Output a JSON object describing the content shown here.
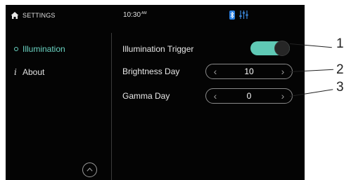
{
  "statusbar": {
    "title": "SETTINGS",
    "time": "10:30",
    "ampm": "AM"
  },
  "sidebar": {
    "items": [
      {
        "label": "Illumination",
        "icon": "dot-icon",
        "active": true
      },
      {
        "label": "About",
        "icon": "info-icon",
        "active": false
      }
    ],
    "info_glyph": "i"
  },
  "settings": {
    "illumination_trigger": {
      "label": "Illumination Trigger",
      "on": true
    },
    "brightness_day": {
      "label": "Brightness Day",
      "value": "10"
    },
    "gamma_day": {
      "label": "Gamma Day",
      "value": "0"
    }
  },
  "callouts": [
    "1",
    "2",
    "3"
  ],
  "colors": {
    "accent": "#5fc9b5",
    "background": "#040404",
    "text": "#e8e8e8",
    "bluetooth": "#2a7fe0",
    "eq": "#3a86d8"
  }
}
